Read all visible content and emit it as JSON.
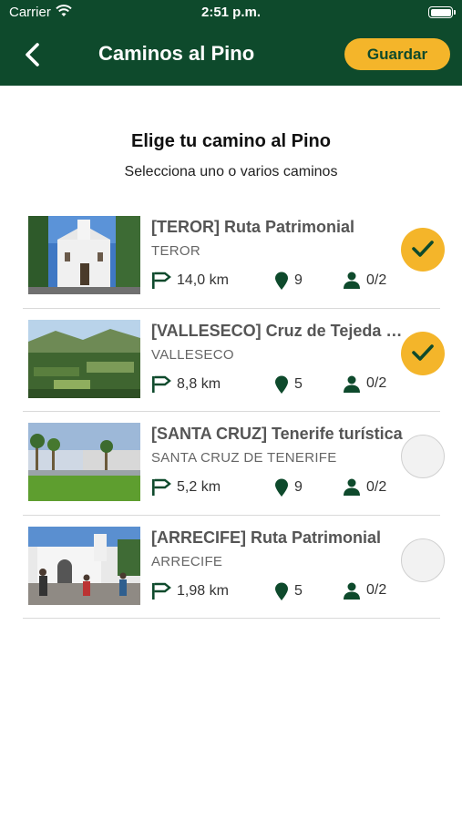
{
  "status_bar": {
    "carrier": "Carrier",
    "time": "2:51 p.m."
  },
  "nav": {
    "title": "Caminos al Pino",
    "save_label": "Guardar"
  },
  "heading": "Elige tu camino al Pino",
  "subheading": "Selecciona uno o varios caminos",
  "routes": [
    {
      "title": "[TEROR] Ruta Patrimonial",
      "city": "TEROR",
      "distance": "14,0 km",
      "stops": "9",
      "participants": "0/2",
      "selected": true
    },
    {
      "title": "[VALLESECO] Cruz de Tejeda a...",
      "city": "VALLESECO",
      "distance": "8,8 km",
      "stops": "5",
      "participants": "0/2",
      "selected": true
    },
    {
      "title": "[SANTA CRUZ] Tenerife turística",
      "city": "SANTA CRUZ DE TENERIFE",
      "distance": "5,2 km",
      "stops": "9",
      "participants": "0/2",
      "selected": false
    },
    {
      "title": "[ARRECIFE] Ruta Patrimonial",
      "city": "ARRECIFE",
      "distance": "1,98 km",
      "stops": "5",
      "participants": "0/2",
      "selected": false
    }
  ],
  "colors": {
    "header": "#0e4a2c",
    "accent": "#f4b52a",
    "icon": "#0e4a2c"
  }
}
